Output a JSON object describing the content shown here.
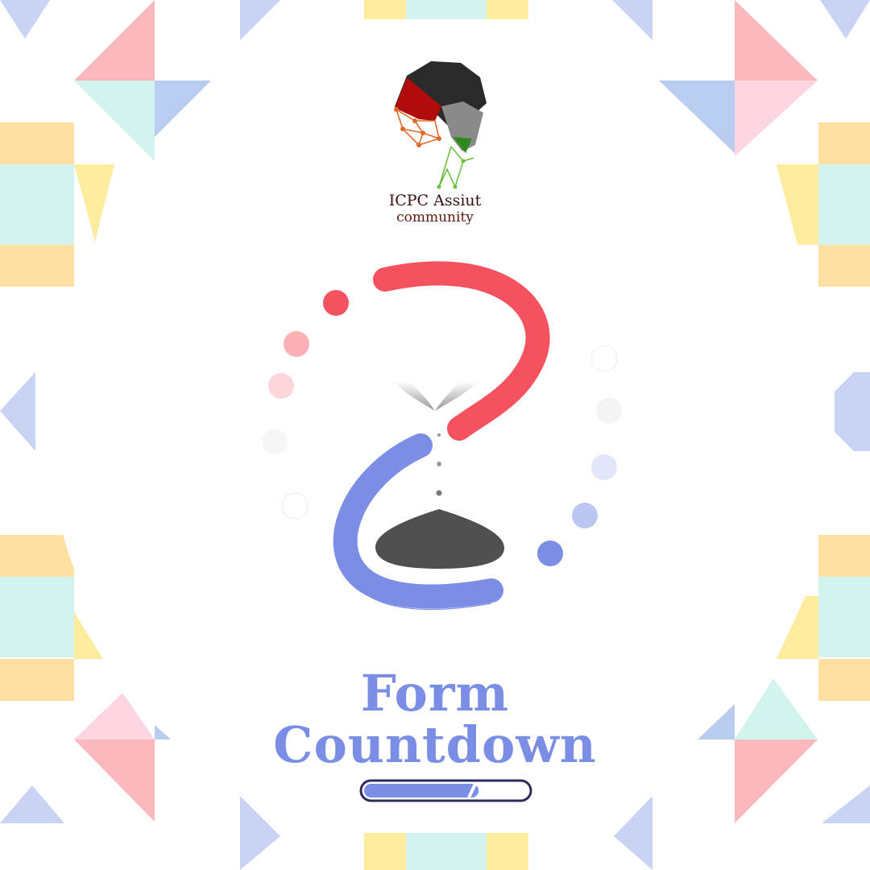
{
  "logo": {
    "line1": "ICPC Assiut",
    "line2": "community"
  },
  "title": {
    "line1": "Form",
    "line2": "Countdown"
  },
  "progress": {
    "fraction": 0.7
  },
  "colors": {
    "pink": "#fbb8bd",
    "light_pink": "#fdd6e0",
    "mint": "#d3f3ef",
    "blue": "#c9d3f4",
    "sky": "#b9cdf1",
    "yellow": "#fdeb9e",
    "peach": "#fde0a2",
    "red": "#f4525e",
    "indigo": "#7b8ee6",
    "sand": "#505050"
  },
  "icons": [
    "icpc-assiut-logo-icon",
    "hourglass-icon",
    "loading-dots-icon"
  ]
}
